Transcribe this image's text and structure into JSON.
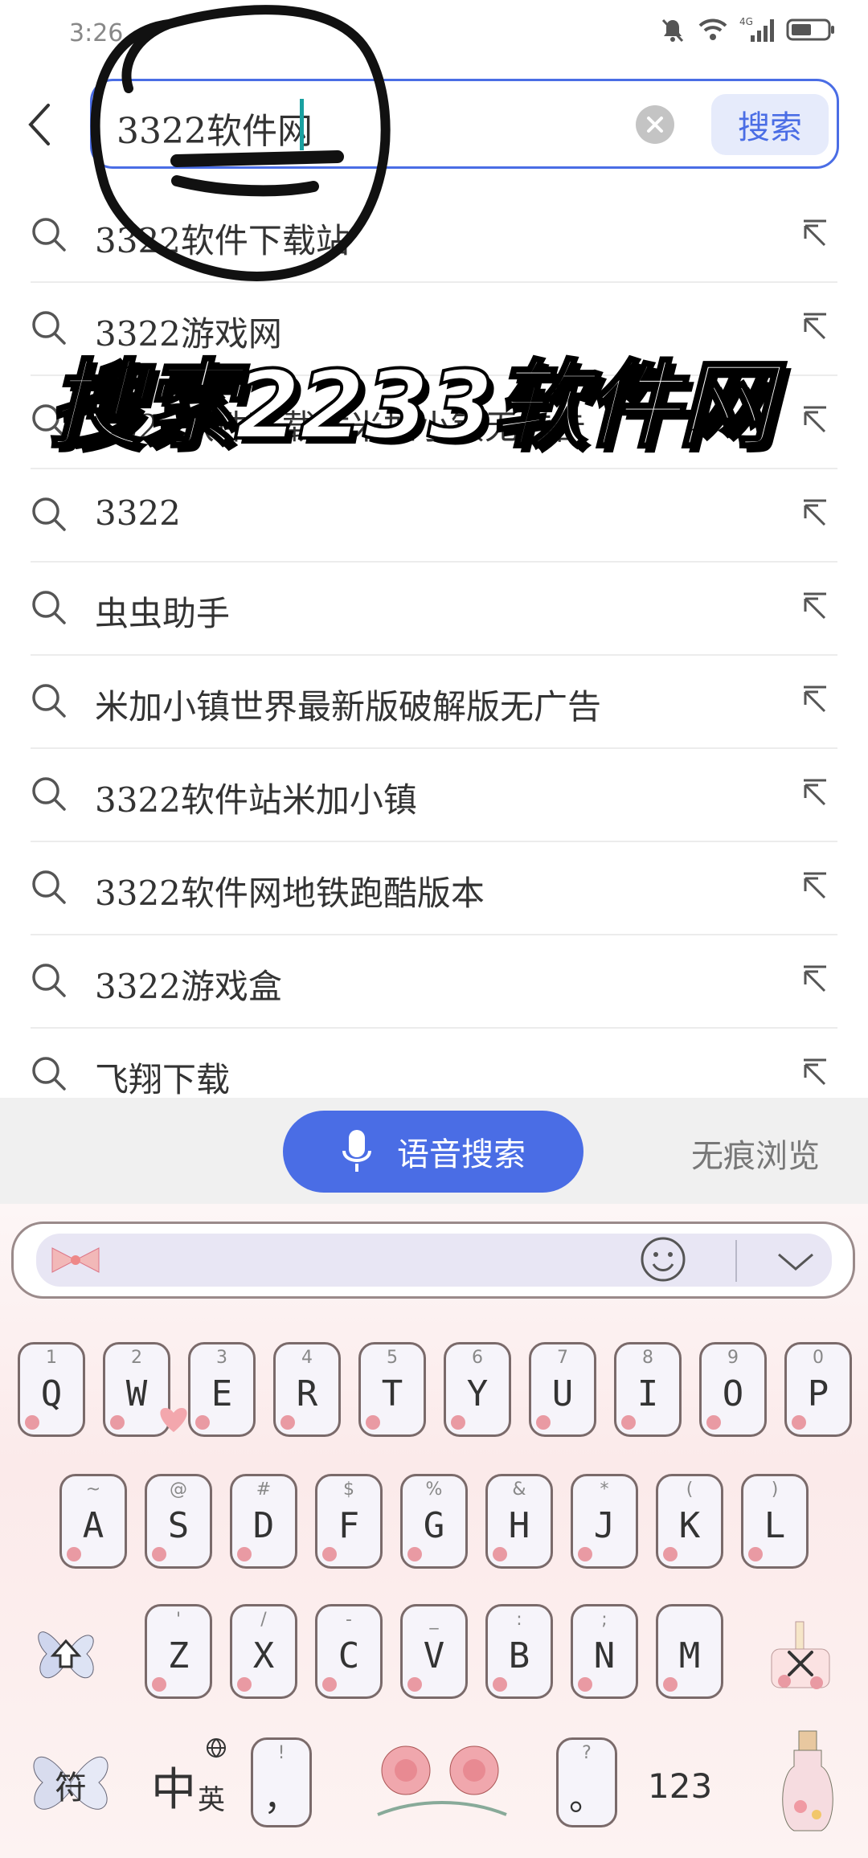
{
  "status_bar": {
    "time": "3:26"
  },
  "search": {
    "value": "3322软件网",
    "button_label": "搜索"
  },
  "suggestions": [
    {
      "text": "3322软件下载站"
    },
    {
      "text": "3322游戏网"
    },
    {
      "text": "3322软件下载站米加小镇无广告"
    },
    {
      "text": "3322"
    },
    {
      "text": "虫虫助手"
    },
    {
      "text": "米加小镇世界最新版破解版无广告"
    },
    {
      "text": "3322软件站米加小镇"
    },
    {
      "text": "3322软件网地铁跑酷版本"
    },
    {
      "text": "3322游戏盒"
    },
    {
      "text": "飞翔下载"
    }
  ],
  "overlay_caption": "搜索2233软件网",
  "bottom_bar": {
    "voice_label": "语音搜索",
    "incognito_label": "无痕浏览"
  },
  "keyboard": {
    "row1": [
      {
        "key": "Q",
        "alt": "1"
      },
      {
        "key": "W",
        "alt": "2"
      },
      {
        "key": "E",
        "alt": "3"
      },
      {
        "key": "R",
        "alt": "4"
      },
      {
        "key": "T",
        "alt": "5"
      },
      {
        "key": "Y",
        "alt": "6"
      },
      {
        "key": "U",
        "alt": "7"
      },
      {
        "key": "I",
        "alt": "8"
      },
      {
        "key": "O",
        "alt": "9"
      },
      {
        "key": "P",
        "alt": "0"
      }
    ],
    "row2": [
      {
        "key": "A",
        "alt": "~"
      },
      {
        "key": "S",
        "alt": "@"
      },
      {
        "key": "D",
        "alt": "#"
      },
      {
        "key": "F",
        "alt": "$"
      },
      {
        "key": "G",
        "alt": "%"
      },
      {
        "key": "H",
        "alt": "&"
      },
      {
        "key": "J",
        "alt": "*"
      },
      {
        "key": "K",
        "alt": "("
      },
      {
        "key": "L",
        "alt": ")"
      }
    ],
    "row3": [
      {
        "key": "Z",
        "alt": "'"
      },
      {
        "key": "X",
        "alt": "/"
      },
      {
        "key": "C",
        "alt": "-"
      },
      {
        "key": "V",
        "alt": "_"
      },
      {
        "key": "B",
        "alt": ":"
      },
      {
        "key": "N",
        "alt": ";"
      },
      {
        "key": "M",
        "alt": ""
      }
    ],
    "symbol_label": "符",
    "lang_main": "中",
    "lang_sub": "英",
    "comma": "，",
    "comma_alt": "!",
    "period": "。",
    "period_alt": "?",
    "numbers_label": "123"
  }
}
